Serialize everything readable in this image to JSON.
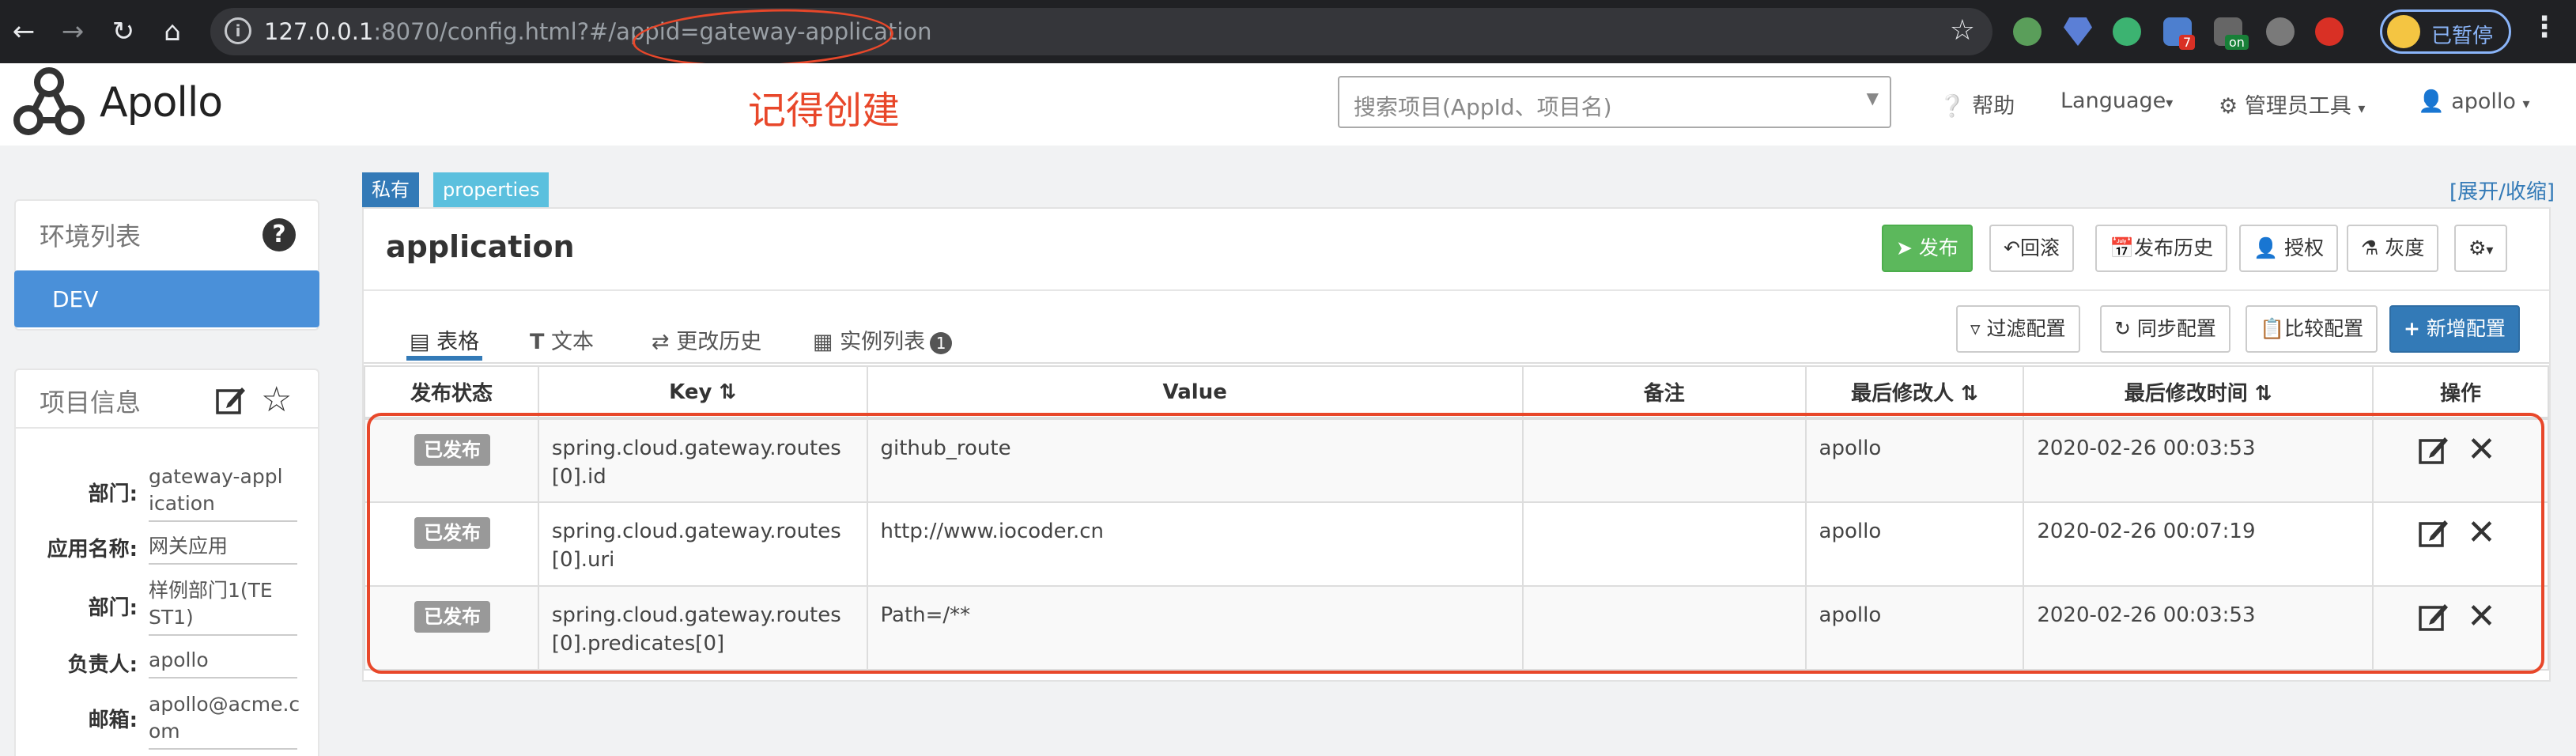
{
  "browser": {
    "url_host": "127.0.0.1",
    "url_rest": ":8070/config.html?#/appid=gateway-application",
    "ext_badge_count": "7",
    "ext_badge_on": "on",
    "paused_label": "已暂停"
  },
  "header": {
    "logo_text": "Apollo",
    "annotation_note": "记得创建",
    "search_placeholder": "搜索项目(AppId、项目名)",
    "help": "帮助",
    "language": "Language",
    "admin_tools": "管理员工具",
    "user": "apollo"
  },
  "env_panel": {
    "title": "环境列表",
    "items": [
      {
        "label": "DEV"
      }
    ]
  },
  "project_panel": {
    "title": "项目信息",
    "rows": [
      {
        "label": "部门:",
        "value": "gateway-appl ication"
      },
      {
        "label": "应用名称:",
        "value": "网关应用"
      },
      {
        "label": "部门:",
        "value": "样例部门1(TE ST1)"
      },
      {
        "label": "负责人:",
        "value": "apollo"
      },
      {
        "label": "邮箱:",
        "value": "apollo@acme.c om"
      }
    ]
  },
  "namespace": {
    "tag_private": "私有",
    "tag_format": "properties",
    "expand_link": "[展开/收缩]",
    "title": "application",
    "actions": {
      "publish": "发布",
      "rollback": "回滚",
      "history": "发布历史",
      "grant": "授权",
      "gray": "灰度"
    },
    "tabs": [
      {
        "label": "表格"
      },
      {
        "label": "文本"
      },
      {
        "label": "更改历史"
      },
      {
        "label": "实例列表",
        "count": "1"
      }
    ],
    "tools": {
      "filter": "过滤配置",
      "sync": "同步配置",
      "compare": "比较配置",
      "add": "新增配置"
    }
  },
  "table": {
    "headers": {
      "status": "发布状态",
      "key": "Key",
      "value": "Value",
      "comment": "备注",
      "modifier": "最后修改人",
      "modified_time": "最后修改时间",
      "ops": "操作"
    },
    "rows": [
      {
        "status": "已发布",
        "key": "spring.cloud.gateway.routes[0].id",
        "value": "github_route",
        "comment": "",
        "modifier": "apollo",
        "time": "2020-02-26 00:03:53"
      },
      {
        "status": "已发布",
        "key": "spring.cloud.gateway.routes[0].uri",
        "value": "http://www.iocoder.cn",
        "comment": "",
        "modifier": "apollo",
        "time": "2020-02-26 00:07:19"
      },
      {
        "status": "已发布",
        "key": "spring.cloud.gateway.routes[0].predicates[0]",
        "value": "Path=/**",
        "comment": "",
        "modifier": "apollo",
        "time": "2020-02-26 00:03:53"
      }
    ]
  },
  "colors": {
    "accent": "#337ab7",
    "publish_green": "#5cb85c",
    "annotation_red": "#e8472a",
    "env_selected": "#4a90d9",
    "tag_private": "#337ab7",
    "tag_format": "#5bc0de"
  },
  "icons": [
    "back-icon",
    "forward-icon",
    "reload-icon",
    "home-icon",
    "info-icon",
    "bookmark-star-icon",
    "help-circle-icon",
    "gear-icon",
    "user-icon",
    "edit-icon",
    "star-icon",
    "send-icon",
    "undo-icon",
    "calendar-icon",
    "filter-icon",
    "sync-icon",
    "clipboard-icon",
    "plus-icon",
    "close-icon",
    "sort-icon",
    "table-icon",
    "text-icon",
    "history-icon",
    "instances-icon"
  ]
}
